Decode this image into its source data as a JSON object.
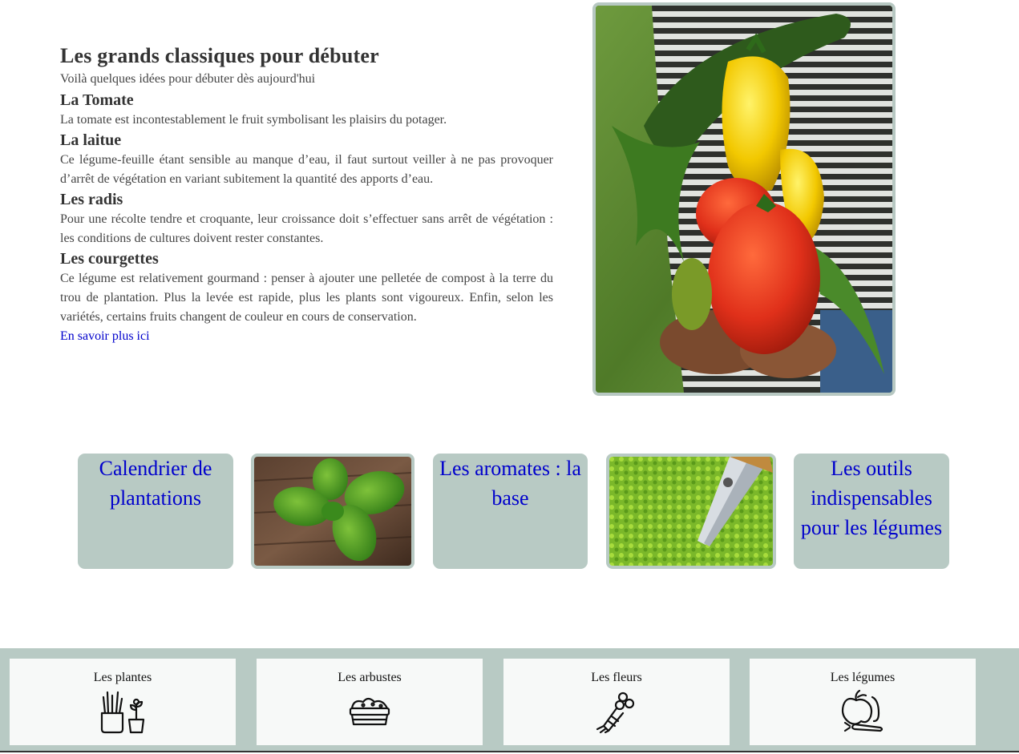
{
  "article": {
    "title": "Les grands classiques pour débuter",
    "intro": "Voilà quelques idées pour débuter dès aujourd'hui",
    "sections": [
      {
        "heading": "La Tomate",
        "text": "La tomate est incontestablement le fruit symbolisant les plaisirs du potager."
      },
      {
        "heading": "La laitue",
        "text": "Ce légume-feuille étant sensible au manque d’eau, il faut surtout veiller à ne pas provoquer d’arrêt de végétation en variant subitement la quantité des apports d’eau."
      },
      {
        "heading": "Les radis",
        "text": "Pour une récolte tendre et croquante, leur croissance doit s’effectuer sans arrêt de végétation : les conditions de cultures doivent rester constantes."
      },
      {
        "heading": "Les courgettes",
        "text": "Ce légume est relativement gourmand : penser à ajouter une pelletée de compost à la terre du trou de plantation. Plus la levée est rapide, plus les plants sont vigoureux. Enfin, selon les variétés, certains fruits changent de couleur en cours de conservation."
      }
    ],
    "more_link": "En savoir plus ici"
  },
  "cards": {
    "calendar": "Calendrier de plantations",
    "aromates": "Les aromates : la base",
    "outils": "Les outils indispensables pour les légumes"
  },
  "footer": {
    "items": [
      {
        "label": "Les plantes",
        "icon": "potted-plants-icon"
      },
      {
        "label": "Les arbustes",
        "icon": "planter-box-icon"
      },
      {
        "label": "Les fleurs",
        "icon": "bouquet-icon"
      },
      {
        "label": "Les légumes",
        "icon": "vegetables-icon"
      }
    ]
  },
  "colors": {
    "accent": "#b8cac4",
    "link": "#0000cc",
    "text": "#333333"
  }
}
